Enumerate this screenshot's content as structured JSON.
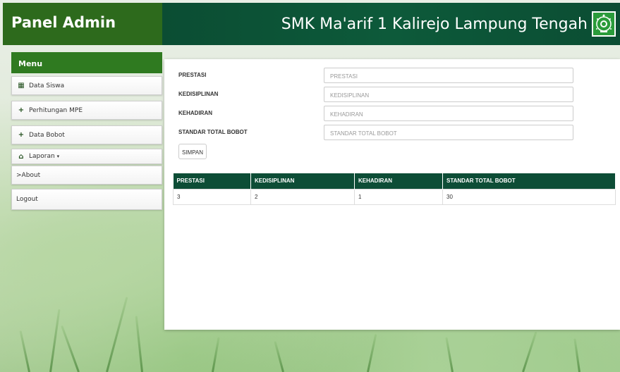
{
  "header": {
    "brand": "Panel Admin",
    "school_name": "SMK Ma'arif 1 Kalirejo Lampung Tengah",
    "logo_icon": "school-emblem-icon"
  },
  "sidebar": {
    "menu_title": "Menu",
    "items": [
      {
        "label": "Data Siswa",
        "icon": "grid-icon",
        "glyph": "▦"
      },
      {
        "label": "Perhitungan MPE",
        "icon": "plus-icon",
        "glyph": "+"
      },
      {
        "label": "Data Bobot",
        "icon": "plus-icon",
        "glyph": "+"
      },
      {
        "label": "Laporan",
        "icon": "bank-icon",
        "glyph": "⌂",
        "caret": "▾"
      },
      {
        "label": ">About"
      },
      {
        "label": "Logout"
      }
    ]
  },
  "form": {
    "fields": [
      {
        "label": "PRESTASI",
        "placeholder": "PRESTASI"
      },
      {
        "label": "KEDISIPLINAN",
        "placeholder": "KEDISIPLINAN"
      },
      {
        "label": "KEHADIRAN",
        "placeholder": "KEHADIRAN"
      },
      {
        "label": "STANDAR TOTAL BOBOT",
        "placeholder": "STANDAR TOTAL BOBOT"
      }
    ],
    "submit_label": "SIMPAN"
  },
  "table": {
    "headers": [
      "PRESTASI",
      "KEDISIPLINAN",
      "KEHADIRAN",
      "STANDAR TOTAL BOBOT"
    ],
    "rows": [
      [
        "3",
        "2",
        "1",
        "30"
      ]
    ]
  },
  "colors": {
    "brand_green": "#2d6a1c",
    "topbar_green": "#0b4d33",
    "table_header": "#0d4d36"
  }
}
